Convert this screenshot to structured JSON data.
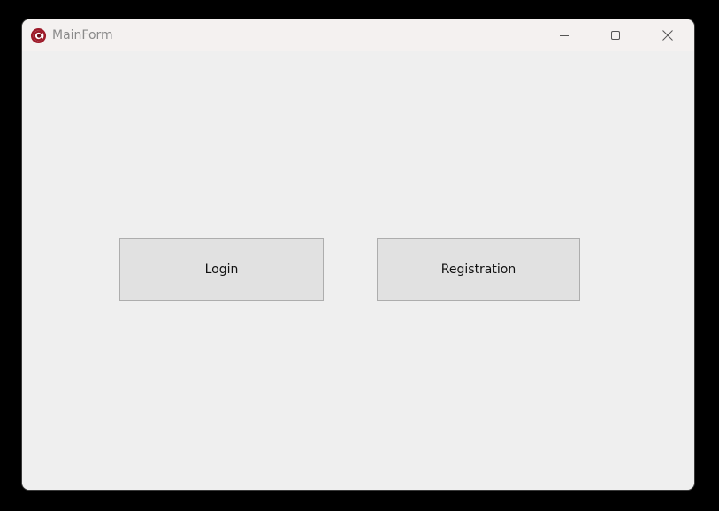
{
  "window": {
    "title": "MainForm",
    "icon": "app-logo-icon",
    "controls": {
      "minimize_icon": "minimize-icon",
      "maximize_icon": "maximize-icon",
      "close_icon": "close-icon"
    }
  },
  "buttons": {
    "login_label": "Login",
    "registration_label": "Registration"
  },
  "colors": {
    "accent": "#9e1b2a",
    "window_background": "#efefef",
    "titlebar_background": "#f4f1f0",
    "button_face": "#e1e1e1",
    "button_border": "#adadad"
  }
}
